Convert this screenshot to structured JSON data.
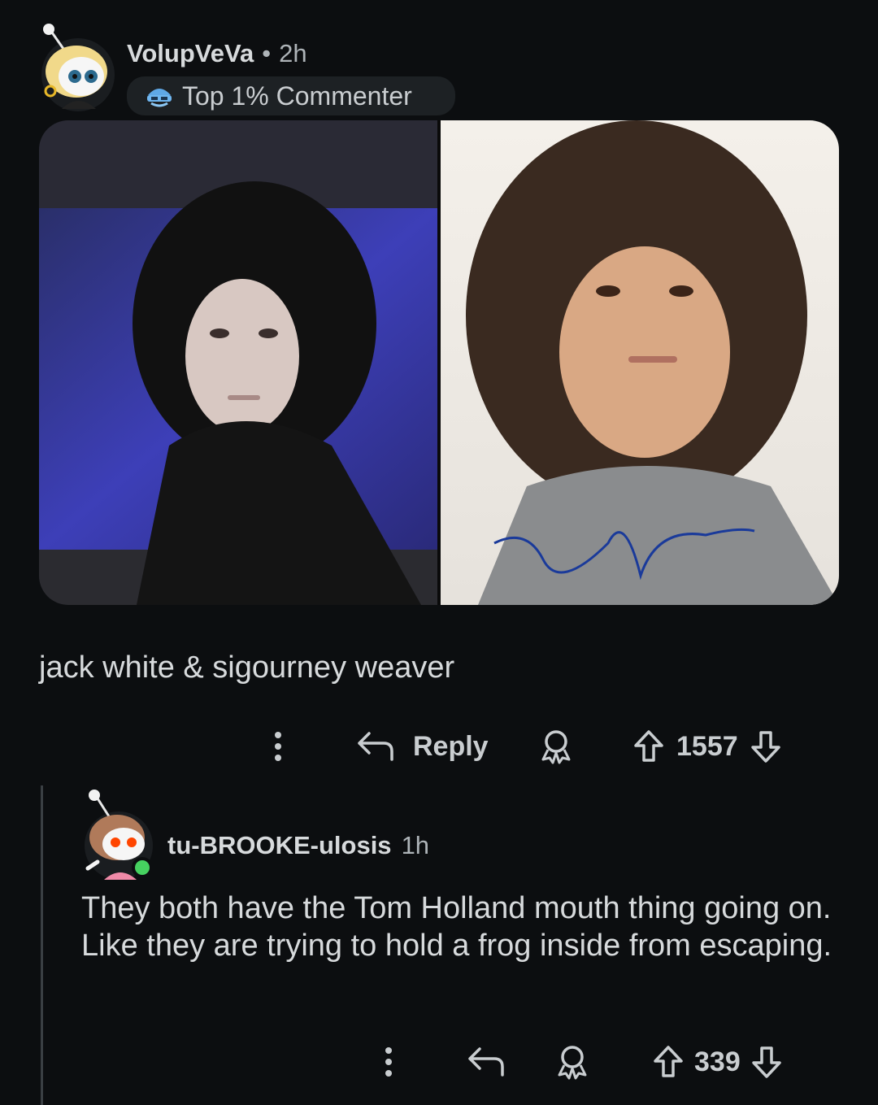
{
  "comment": {
    "author": "VolupVeVa",
    "separator": "•",
    "age": "2h",
    "badge": "Top 1% Commenter",
    "text": "jack white & sigourney weaver",
    "actions": {
      "reply": "Reply",
      "votes": "1557"
    }
  },
  "reply": {
    "author": "tu-BROOKE-ulosis",
    "age": "1h",
    "text": "They both have the Tom Holland mouth thing going on. Like they are trying to hold a frog inside from escaping.",
    "actions": {
      "votes": "339"
    }
  },
  "colors": {
    "background": "#0c0e10",
    "text": "#d7dadc",
    "online": "#46d160"
  }
}
